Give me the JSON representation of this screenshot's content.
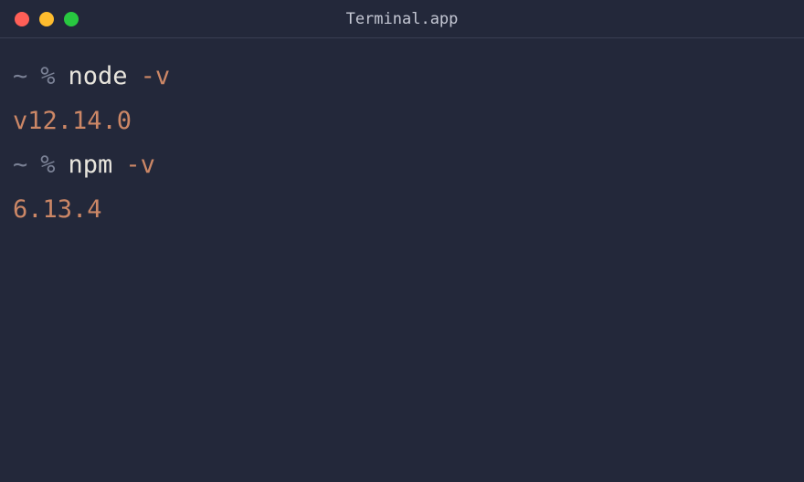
{
  "window": {
    "title": "Terminal.app"
  },
  "terminal": {
    "lines": [
      {
        "prompt_path": "~",
        "prompt_symbol": "%",
        "command": "node",
        "flag": "-v"
      },
      {
        "output": "v12.14.0"
      },
      {
        "prompt_path": "~",
        "prompt_symbol": "%",
        "command": "npm",
        "flag": "-v"
      },
      {
        "output": "6.13.4"
      }
    ]
  }
}
